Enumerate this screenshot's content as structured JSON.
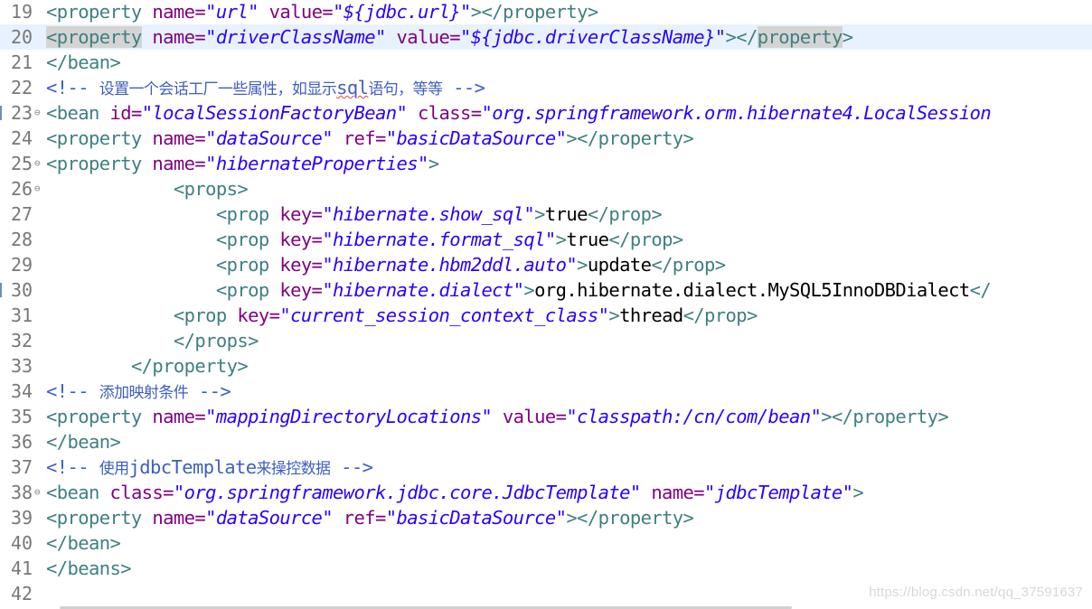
{
  "colors": {
    "tag": "#3f7f7f",
    "attribute": "#7f007f",
    "value": "#2a00ff",
    "comment": "#3f5fbf",
    "current_line": "#e8f2fe"
  },
  "lines": [
    {
      "n": "19",
      "tokens": [
        {
          "t": "<property",
          "c": "tag"
        },
        {
          "t": " name=",
          "c": "attr"
        },
        {
          "t": "\"url\"",
          "c": "val"
        },
        {
          "t": " value=",
          "c": "attr"
        },
        {
          "t": "\"${jdbc.url}\"",
          "c": "val"
        },
        {
          "t": "></property>",
          "c": "tag"
        }
      ]
    },
    {
      "n": "20",
      "current": true,
      "tokens": [
        {
          "t": "<property",
          "c": "tag",
          "hl": true
        },
        {
          "t": " name=",
          "c": "attr"
        },
        {
          "t": "\"driverClassName\"",
          "c": "val"
        },
        {
          "t": " value=",
          "c": "attr"
        },
        {
          "t": "\"${jdbc.driverClassName}\"",
          "c": "val"
        },
        {
          "t": "></",
          "c": "tag"
        },
        {
          "t": "property",
          "c": "tag",
          "hl": true
        },
        {
          "t": ">",
          "c": "tag"
        }
      ]
    },
    {
      "n": "21",
      "tokens": [
        {
          "t": "</bean>",
          "c": "tag"
        }
      ]
    },
    {
      "n": "22",
      "tokens": [
        {
          "t": "<!-- ",
          "c": "com"
        },
        {
          "t": "设置一个会话工厂一些属性，如显示",
          "c": "com-cjk"
        },
        {
          "t": "sql",
          "c": "com",
          "squig": true
        },
        {
          "t": "语句，等等",
          "c": "com-cjk"
        },
        {
          "t": " -->",
          "c": "com"
        }
      ]
    },
    {
      "n": "23",
      "fold": true,
      "edge": true,
      "tokens": [
        {
          "t": "<bean",
          "c": "tag"
        },
        {
          "t": " id=",
          "c": "attr"
        },
        {
          "t": "\"localSessionFactoryBean\"",
          "c": "val"
        },
        {
          "t": " class=",
          "c": "attr"
        },
        {
          "t": "\"org.springframework.orm.hibernate4.LocalSession",
          "c": "val"
        }
      ]
    },
    {
      "n": "24",
      "tokens": [
        {
          "t": "<property",
          "c": "tag"
        },
        {
          "t": " name=",
          "c": "attr"
        },
        {
          "t": "\"dataSource\"",
          "c": "val"
        },
        {
          "t": " ref=",
          "c": "attr"
        },
        {
          "t": "\"basicDataSource\"",
          "c": "val"
        },
        {
          "t": "></property>",
          "c": "tag"
        }
      ]
    },
    {
      "n": "25",
      "fold": true,
      "tokens": [
        {
          "t": "<property",
          "c": "tag"
        },
        {
          "t": " name=",
          "c": "attr"
        },
        {
          "t": "\"hibernateProperties\"",
          "c": "val"
        },
        {
          "t": ">",
          "c": "tag"
        }
      ]
    },
    {
      "n": "26",
      "fold": true,
      "tokens": [
        {
          "t": "            ",
          "c": "text"
        },
        {
          "t": "<props>",
          "c": "tag"
        }
      ]
    },
    {
      "n": "27",
      "tokens": [
        {
          "t": "                ",
          "c": "text"
        },
        {
          "t": "<prop",
          "c": "tag"
        },
        {
          "t": " key=",
          "c": "attr"
        },
        {
          "t": "\"hibernate.show_sql\"",
          "c": "val"
        },
        {
          "t": ">",
          "c": "tag"
        },
        {
          "t": "true",
          "c": "text"
        },
        {
          "t": "</prop>",
          "c": "tag"
        }
      ]
    },
    {
      "n": "28",
      "tokens": [
        {
          "t": "                ",
          "c": "text"
        },
        {
          "t": "<prop",
          "c": "tag"
        },
        {
          "t": " key=",
          "c": "attr"
        },
        {
          "t": "\"hibernate.format_sql\"",
          "c": "val"
        },
        {
          "t": ">",
          "c": "tag"
        },
        {
          "t": "true",
          "c": "text"
        },
        {
          "t": "</prop>",
          "c": "tag"
        }
      ]
    },
    {
      "n": "29",
      "tokens": [
        {
          "t": "                ",
          "c": "text"
        },
        {
          "t": "<prop",
          "c": "tag"
        },
        {
          "t": " key=",
          "c": "attr"
        },
        {
          "t": "\"hibernate.hbm2ddl.auto\"",
          "c": "val"
        },
        {
          "t": ">",
          "c": "tag"
        },
        {
          "t": "update",
          "c": "text"
        },
        {
          "t": "</prop>",
          "c": "tag"
        }
      ]
    },
    {
      "n": "30",
      "edge": true,
      "tokens": [
        {
          "t": "                ",
          "c": "text"
        },
        {
          "t": "<prop",
          "c": "tag"
        },
        {
          "t": " key=",
          "c": "attr"
        },
        {
          "t": "\"hibernate.dialect\"",
          "c": "val"
        },
        {
          "t": ">",
          "c": "tag"
        },
        {
          "t": "org.hibernate.dialect.MySQL5InnoDBDialect",
          "c": "text"
        },
        {
          "t": "</",
          "c": "tag"
        }
      ]
    },
    {
      "n": "31",
      "tokens": [
        {
          "t": "            ",
          "c": "text"
        },
        {
          "t": "<prop",
          "c": "tag"
        },
        {
          "t": " key=",
          "c": "attr"
        },
        {
          "t": "\"current_session_context_class\"",
          "c": "val"
        },
        {
          "t": ">",
          "c": "tag"
        },
        {
          "t": "thread",
          "c": "text"
        },
        {
          "t": "</prop>",
          "c": "tag"
        }
      ]
    },
    {
      "n": "32",
      "tokens": [
        {
          "t": "            ",
          "c": "text"
        },
        {
          "t": "</props>",
          "c": "tag"
        }
      ]
    },
    {
      "n": "33",
      "tokens": [
        {
          "t": "        ",
          "c": "text"
        },
        {
          "t": "</property>",
          "c": "tag"
        }
      ]
    },
    {
      "n": "34",
      "tokens": [
        {
          "t": "<!-- ",
          "c": "com"
        },
        {
          "t": "添加映射条件",
          "c": "com-cjk"
        },
        {
          "t": " -->",
          "c": "com"
        }
      ]
    },
    {
      "n": "35",
      "tokens": [
        {
          "t": "<property",
          "c": "tag"
        },
        {
          "t": " name=",
          "c": "attr"
        },
        {
          "t": "\"mappingDirectoryLocations\"",
          "c": "val"
        },
        {
          "t": " value=",
          "c": "attr"
        },
        {
          "t": "\"classpath:/cn/com/bean\"",
          "c": "val"
        },
        {
          "t": "></property>",
          "c": "tag"
        }
      ]
    },
    {
      "n": "36",
      "tokens": [
        {
          "t": "</bean>",
          "c": "tag"
        }
      ]
    },
    {
      "n": "37",
      "tokens": [
        {
          "t": "<!-- ",
          "c": "com"
        },
        {
          "t": "使用",
          "c": "com-cjk"
        },
        {
          "t": "jdbcTemplate",
          "c": "com"
        },
        {
          "t": "来操控数据",
          "c": "com-cjk"
        },
        {
          "t": " -->",
          "c": "com"
        }
      ]
    },
    {
      "n": "38",
      "fold": true,
      "tokens": [
        {
          "t": "<bean",
          "c": "tag"
        },
        {
          "t": " class=",
          "c": "attr"
        },
        {
          "t": "\"org.springframework.jdbc.core.JdbcTemplate\"",
          "c": "val"
        },
        {
          "t": " name=",
          "c": "attr"
        },
        {
          "t": "\"jdbcTemplate\"",
          "c": "val"
        },
        {
          "t": ">",
          "c": "tag"
        }
      ]
    },
    {
      "n": "39",
      "tokens": [
        {
          "t": "<property",
          "c": "tag"
        },
        {
          "t": " name=",
          "c": "attr"
        },
        {
          "t": "\"dataSource\"",
          "c": "val"
        },
        {
          "t": " ref=",
          "c": "attr"
        },
        {
          "t": "\"basicDataSource\"",
          "c": "val"
        },
        {
          "t": "></property>",
          "c": "tag"
        }
      ]
    },
    {
      "n": "40",
      "tokens": [
        {
          "t": "</bean>",
          "c": "tag"
        }
      ]
    },
    {
      "n": "41",
      "tokens": [
        {
          "t": "</beans>",
          "c": "tag"
        }
      ]
    },
    {
      "n": "42",
      "tokens": []
    }
  ],
  "watermark": "https://blog.csdn.net/qq_37591637"
}
